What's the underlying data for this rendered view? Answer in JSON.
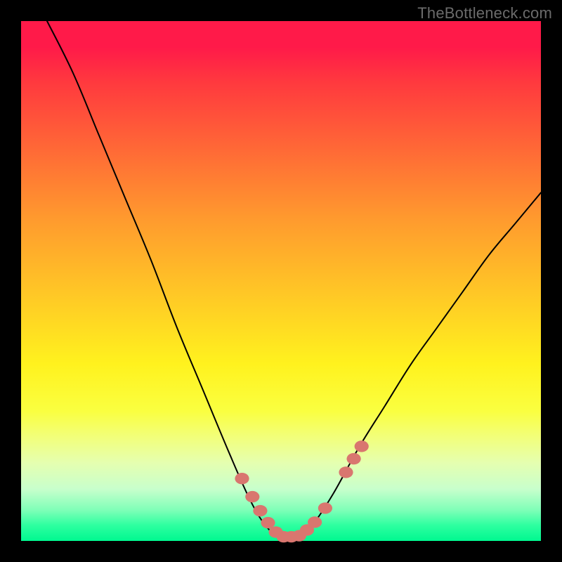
{
  "watermark": "TheBottleneck.com",
  "colors": {
    "frame": "#000000",
    "curve_stroke": "#000000",
    "marker_fill": "#d9766f",
    "marker_stroke": "#d9766f"
  },
  "chart_data": {
    "type": "line",
    "title": "",
    "xlabel": "",
    "ylabel": "",
    "xlim": [
      0,
      100
    ],
    "ylim": [
      0,
      100
    ],
    "grid": false,
    "curve": [
      {
        "x": 5,
        "y": 100
      },
      {
        "x": 10,
        "y": 90
      },
      {
        "x": 15,
        "y": 78
      },
      {
        "x": 20,
        "y": 66
      },
      {
        "x": 25,
        "y": 54
      },
      {
        "x": 30,
        "y": 41
      },
      {
        "x": 35,
        "y": 29
      },
      {
        "x": 40,
        "y": 17
      },
      {
        "x": 44,
        "y": 8
      },
      {
        "x": 47,
        "y": 3
      },
      {
        "x": 50,
        "y": 0.5
      },
      {
        "x": 53,
        "y": 0.5
      },
      {
        "x": 56,
        "y": 3
      },
      {
        "x": 60,
        "y": 9
      },
      {
        "x": 65,
        "y": 18
      },
      {
        "x": 70,
        "y": 26
      },
      {
        "x": 75,
        "y": 34
      },
      {
        "x": 80,
        "y": 41
      },
      {
        "x": 85,
        "y": 48
      },
      {
        "x": 90,
        "y": 55
      },
      {
        "x": 95,
        "y": 61
      },
      {
        "x": 100,
        "y": 67
      }
    ],
    "markers": [
      {
        "x": 42.5,
        "y": 12
      },
      {
        "x": 44.5,
        "y": 8.5
      },
      {
        "x": 46.0,
        "y": 5.8
      },
      {
        "x": 47.5,
        "y": 3.5
      },
      {
        "x": 49.0,
        "y": 1.7
      },
      {
        "x": 50.5,
        "y": 0.8
      },
      {
        "x": 52.0,
        "y": 0.8
      },
      {
        "x": 53.5,
        "y": 1.0
      },
      {
        "x": 55.0,
        "y": 2.1
      },
      {
        "x": 56.5,
        "y": 3.6
      },
      {
        "x": 58.5,
        "y": 6.3
      },
      {
        "x": 62.5,
        "y": 13.2
      },
      {
        "x": 64.0,
        "y": 15.8
      },
      {
        "x": 65.5,
        "y": 18.2
      }
    ],
    "marker_radius_pct": 1.3,
    "note": "Values are percentages of the plot area; y=0 at the bottom (green band) and y=100 at the top (red band). Markers cluster near the valley floor and lower flanks."
  }
}
